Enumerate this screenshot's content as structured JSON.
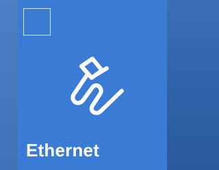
{
  "tile": {
    "label": "Ethernet",
    "icon": "ethernet-cable-icon",
    "selected": false
  },
  "colors": {
    "tile_background": "#3a7bd6",
    "text": "#ffffff"
  }
}
